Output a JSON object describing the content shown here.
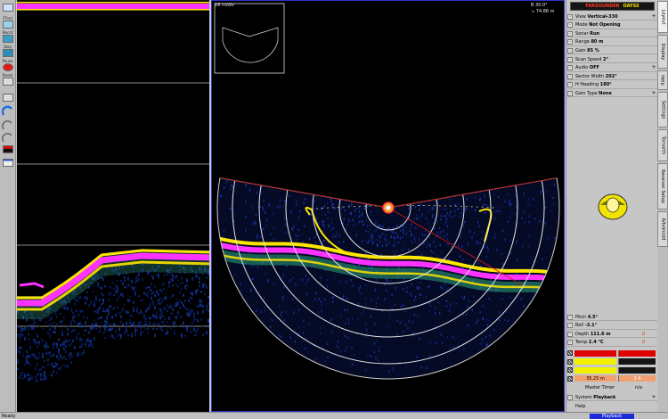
{
  "toolbar": {
    "items": [
      {
        "label": "",
        "icon": "grid-icon"
      },
      {
        "label": "FFrsd",
        "icon": "forward-icon"
      },
      {
        "label": "Recrd",
        "icon": "record-icon"
      },
      {
        "label": "Stop",
        "icon": "stop-icon"
      },
      {
        "label": "Pause",
        "icon": "pause-icon"
      },
      {
        "label": "Reset",
        "icon": "reset-icon"
      },
      {
        "label": "",
        "icon": "gauge-icon"
      },
      {
        "label": "",
        "icon": "gauge-small-icon"
      },
      {
        "label": "",
        "icon": "gauge-small-icon"
      },
      {
        "label": "",
        "icon": "alert-icon"
      },
      {
        "label": "",
        "icon": "window-icon"
      }
    ]
  },
  "sonar": {
    "scale_label": "16 m/div",
    "bearing_readout": "B 30.0°",
    "range_readout": "↘ 74.86 m"
  },
  "panel": {
    "logo_left": "FARSOUNDER",
    "logo_right": "OAYSS",
    "settings": [
      {
        "label": "View",
        "value": "Vertical-330",
        "expand": true
      },
      {
        "label": "Mode",
        "value": "Not Opening"
      },
      {
        "label": "Sonar",
        "value": "Run"
      },
      {
        "label": "Range",
        "value": "80 m"
      },
      {
        "label": "Gain",
        "value": "85 %"
      },
      {
        "label": "Scan Speed",
        "value": "2°"
      },
      {
        "label": "Audio",
        "value": "OFF",
        "expand": true
      },
      {
        "label": "Sector Width",
        "value": "202°"
      },
      {
        "label": "H Heading",
        "value": "180°"
      },
      {
        "label": "Gain Type",
        "value": "None",
        "expand": true
      }
    ],
    "readouts": [
      {
        "label": "Pitch",
        "value": "4.5°"
      },
      {
        "label": "Roll",
        "value": "-3.1°"
      },
      {
        "label": "Depth",
        "value": "111.6 m"
      },
      {
        "label": "Temp",
        "value": "2.4 °C"
      }
    ],
    "readout_extras": {
      "depth_marker": "0",
      "temp_marker": "0"
    },
    "signals": [
      {
        "text": "",
        "color": "#e00000"
      },
      {
        "text": "",
        "color": "#f2f200"
      },
      {
        "text": "",
        "color": "#f2f200"
      },
      {
        "text": "35.25 m",
        "text2": "3 A",
        "color": "#f0a070"
      }
    ],
    "master_timer_label": "Master Timer",
    "master_timer_value": "n/a",
    "system_label": "System",
    "system_value": "Playback",
    "help_label": "Help"
  },
  "tabs": [
    "Layout",
    "Display",
    "Help",
    "Settings",
    "Tornorth",
    "Receiver Setup",
    "Advanced"
  ],
  "status": {
    "ready": "Ready",
    "mode": "Playback"
  },
  "colors": {
    "echo_pink": "#ff33ff",
    "echo_yellow": "#ffe600",
    "echo_blue": "#1020a0",
    "frame_blue": "#2a35d0",
    "signal_red": "#e00000"
  }
}
